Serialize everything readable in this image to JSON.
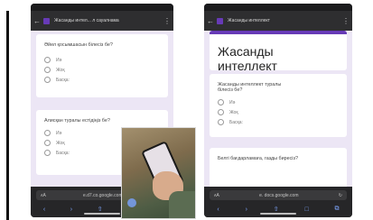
{
  "phone1": {
    "header_title": "Жасанды интел... л сауалнама",
    "questions": [
      {
        "text": "Әйел қосымшасын білесіз бе?",
        "options": [
          "Иә",
          "Жоқ",
          "Басқа:"
        ]
      },
      {
        "text": "Алисқан туралы естідіңіз бе?",
        "options": [
          "Иә",
          "Жоқ",
          "Басқа:"
        ]
      }
    ],
    "url": "e.d7.co.google.com"
  },
  "phone2": {
    "header_title": "Жасанды интеллект",
    "form_title": "Жасанды интеллект",
    "questions": [
      {
        "text": "Жасанды интеллект туралы білесіз бе?",
        "options": [
          "Иә",
          "Жоқ",
          "Басқа:"
        ]
      },
      {
        "text": "Белгі бағдарламаға, газды биресіз?"
      }
    ],
    "url": "e. docs.google.com"
  },
  "icons": {
    "back": "back-arrow-icon",
    "more": "more-vert-icon",
    "form": "google-forms-icon"
  },
  "colors": {
    "accent": "#673ab7",
    "page_bg": "#ece6f5"
  }
}
